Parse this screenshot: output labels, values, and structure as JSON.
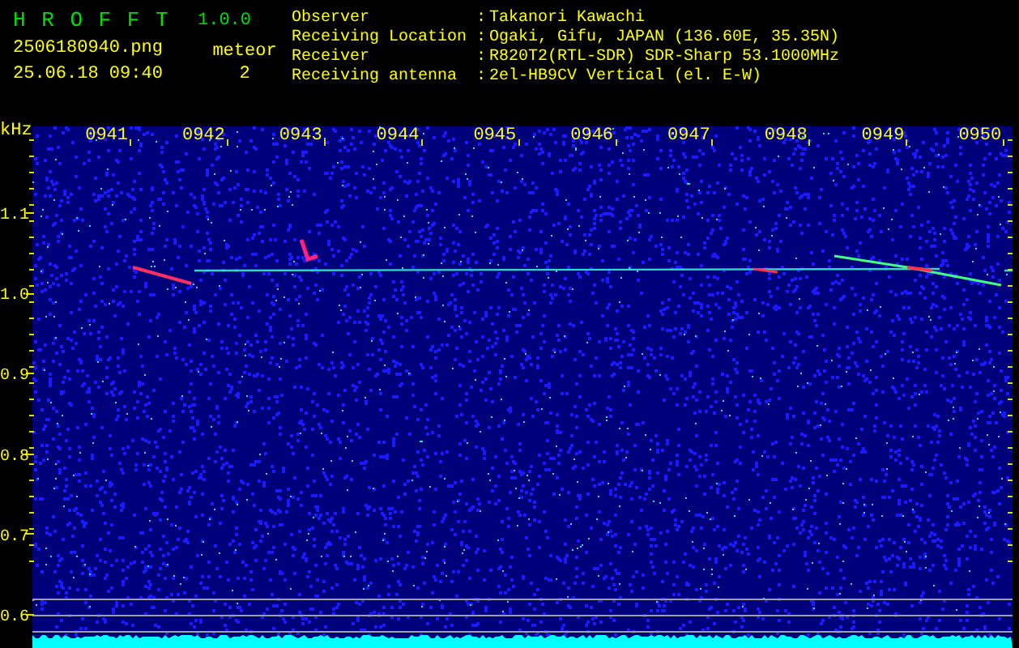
{
  "app": {
    "title": "H R O F F T",
    "version": "1.0.0",
    "filename": "2506180940.png",
    "datetime": "25.06.18 09:40",
    "count_label": "meteor",
    "count": "2"
  },
  "station": [
    {
      "label": "Observer",
      "separator": ":",
      "value": "Takanori Kawachi"
    },
    {
      "label": "Receiving Location",
      "separator": ":",
      "value": "Ogaki, Gifu, JAPAN (136.60E, 35.35N)"
    },
    {
      "label": "Receiver",
      "separator": ":",
      "value": "R820T2(RTL-SDR) SDR-Sharp 53.1000MHz"
    },
    {
      "label": "Receiving antenna",
      "separator": ":",
      "value": "2el-HB9CV Vertical (el. E-W)"
    }
  ],
  "spectrogram": {
    "unit": "kHz",
    "time_labels": [
      "0941",
      "0942",
      "0943",
      "0944",
      "0945",
      "0946",
      "0947",
      "0948",
      "0949",
      "0950"
    ],
    "freq_labels": [
      "1.1",
      "1.0",
      "0.9",
      "0.8",
      "0.7",
      "0.6"
    ]
  }
}
